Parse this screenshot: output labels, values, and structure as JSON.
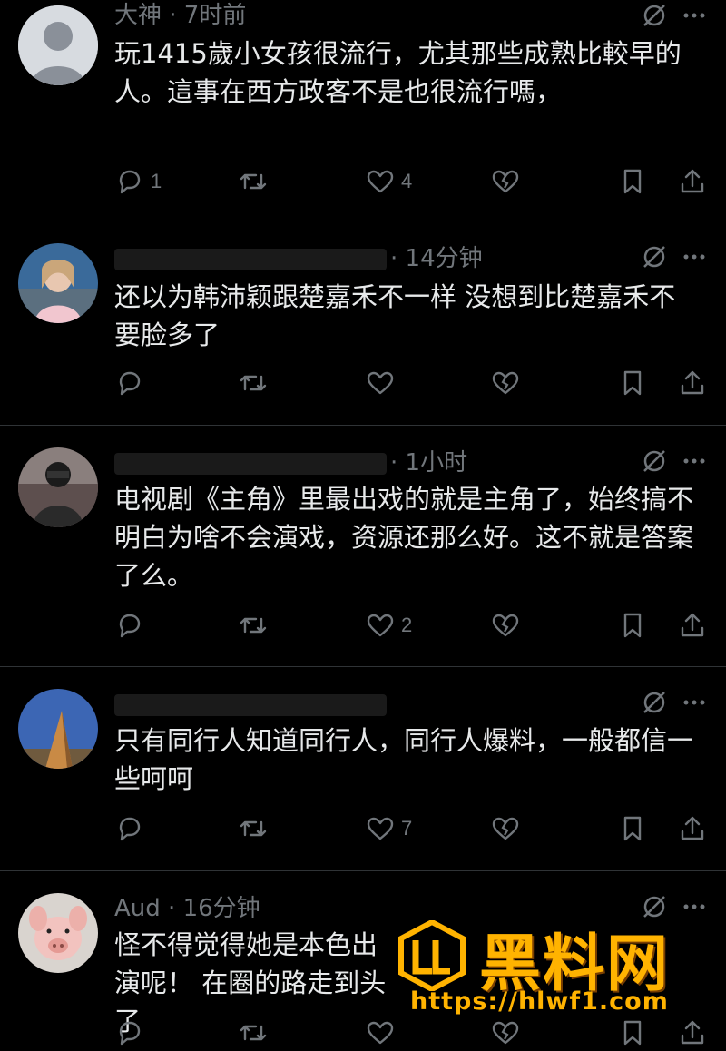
{
  "posts": [
    {
      "header": "大神 · 7时前",
      "content": "玩1415歲小女孩很流行，尤其那些成熟比較早的人。這事在西方政客不是也很流行嗎，",
      "counts": {
        "reply": "1",
        "retweet": "",
        "like": "4"
      }
    },
    {
      "header": "· 14分钟",
      "content": "还以为韩沛颖跟楚嘉禾不一样 没想到比楚嘉禾不要脸多了",
      "counts": {
        "reply": "",
        "retweet": "",
        "like": ""
      }
    },
    {
      "header": "· 1小时",
      "content": "电视剧《主角》里最出戏的就是主角了，始终搞不明白为啥不会演戏，资源还那么好。这不就是答案了么。",
      "counts": {
        "reply": "",
        "retweet": "",
        "like": "2"
      }
    },
    {
      "header": "",
      "content": "只有同行人知道同行人，同行人爆料，一般都信一些呵呵",
      "counts": {
        "reply": "",
        "retweet": "",
        "like": "7"
      }
    },
    {
      "header": "Aud · 16分钟",
      "content": "怪不得觉得她是本色出演呢！ 在圈的路走到头了",
      "counts": {
        "reply": "",
        "retweet": "",
        "like": ""
      }
    }
  ],
  "watermark": {
    "title": "黑料网",
    "url": "https://hlwf1.com"
  },
  "colors": {
    "background": "#000000",
    "text": "#e7e9ea",
    "muted": "#71767b",
    "divider": "#2f3336",
    "watermark": "#ffb300"
  }
}
